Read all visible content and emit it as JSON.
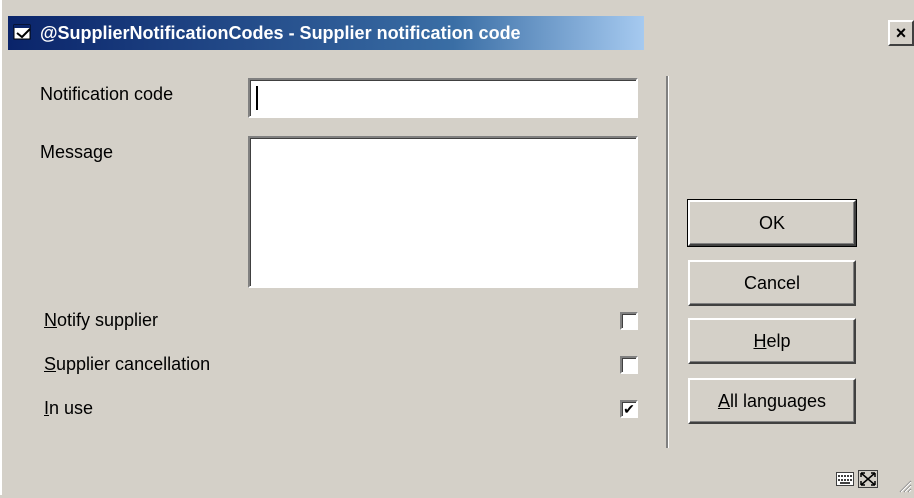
{
  "window": {
    "title": "@SupplierNotificationCodes - Supplier notification code",
    "close_label": "×"
  },
  "form": {
    "notification_code": {
      "label": "Notification code",
      "value": ""
    },
    "message": {
      "label": "Message",
      "value": ""
    },
    "notify_supplier": {
      "label_mnemonic": "N",
      "label_rest": "otify supplier",
      "checked": false
    },
    "supplier_cancellation": {
      "label_mnemonic": "S",
      "label_rest": "upplier cancellation",
      "checked": false
    },
    "in_use": {
      "label_mnemonic": "I",
      "label_rest": "n use",
      "checked": true,
      "check_glyph": "✔"
    }
  },
  "buttons": {
    "ok": "OK",
    "cancel": "Cancel",
    "help_mnemonic": "H",
    "help_rest": "elp",
    "all_languages_mnemonic": "A",
    "all_languages_rest": "ll languages"
  },
  "icons": {
    "title": "dialog-icon",
    "keyboard": "keyboard-icon",
    "resize": "resize-icon",
    "grip": "size-grip-icon"
  }
}
